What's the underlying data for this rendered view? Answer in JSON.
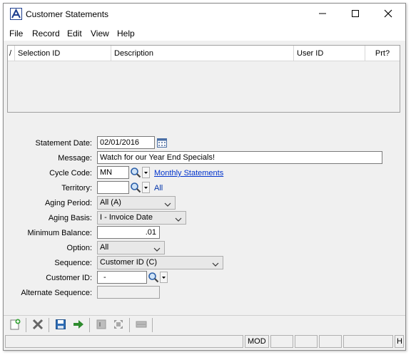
{
  "window": {
    "title": "Customer Statements",
    "controls": {
      "minimize_icon": "minimize-icon",
      "maximize_icon": "maximize-icon",
      "close_icon": "close-icon"
    }
  },
  "menu": [
    {
      "label": "File"
    },
    {
      "label": "Record"
    },
    {
      "label": "Edit"
    },
    {
      "label": "View"
    },
    {
      "label": "Help"
    }
  ],
  "grid": {
    "marker": "/",
    "columns": [
      "Selection ID",
      "Description",
      "User ID",
      "Prt?"
    ],
    "rows": []
  },
  "form": {
    "statement_date": {
      "label": "Statement Date:",
      "value": "02/01/2016"
    },
    "message": {
      "label": "Message:",
      "value": "Watch for our Year End Specials!"
    },
    "cycle_code": {
      "label": "Cycle Code:",
      "value": "MN",
      "description": "Monthly Statements"
    },
    "territory": {
      "label": "Territory:",
      "value": "",
      "description": "All"
    },
    "aging_period": {
      "label": "Aging Period:",
      "value": "All (A)"
    },
    "aging_basis": {
      "label": "Aging Basis:",
      "value": "I - Invoice Date"
    },
    "minimum_balance": {
      "label": "Minimum Balance:",
      "value": ".01"
    },
    "option": {
      "label": "Option:",
      "value": "All"
    },
    "sequence": {
      "label": "Sequence:",
      "value": "Customer ID (C)"
    },
    "customer_id": {
      "label": "Customer ID:",
      "value": "-"
    },
    "alternate_sequence": {
      "label": "Alternate Sequence:",
      "value": ""
    }
  },
  "toolbar": {
    "buttons": [
      "new-record-icon",
      "delete-icon",
      "save-icon",
      "next-arrow-icon",
      "first-record-icon",
      "expand-icon",
      "list-icon"
    ]
  },
  "statusbar": {
    "cells": [
      "",
      "MOD",
      "",
      "",
      "",
      "",
      "HI"
    ]
  },
  "colors": {
    "accent": "#1f3f8f",
    "link": "#0033cc",
    "window_bg": "#f0f0f0",
    "arrow_green": "#2e8b2e"
  }
}
